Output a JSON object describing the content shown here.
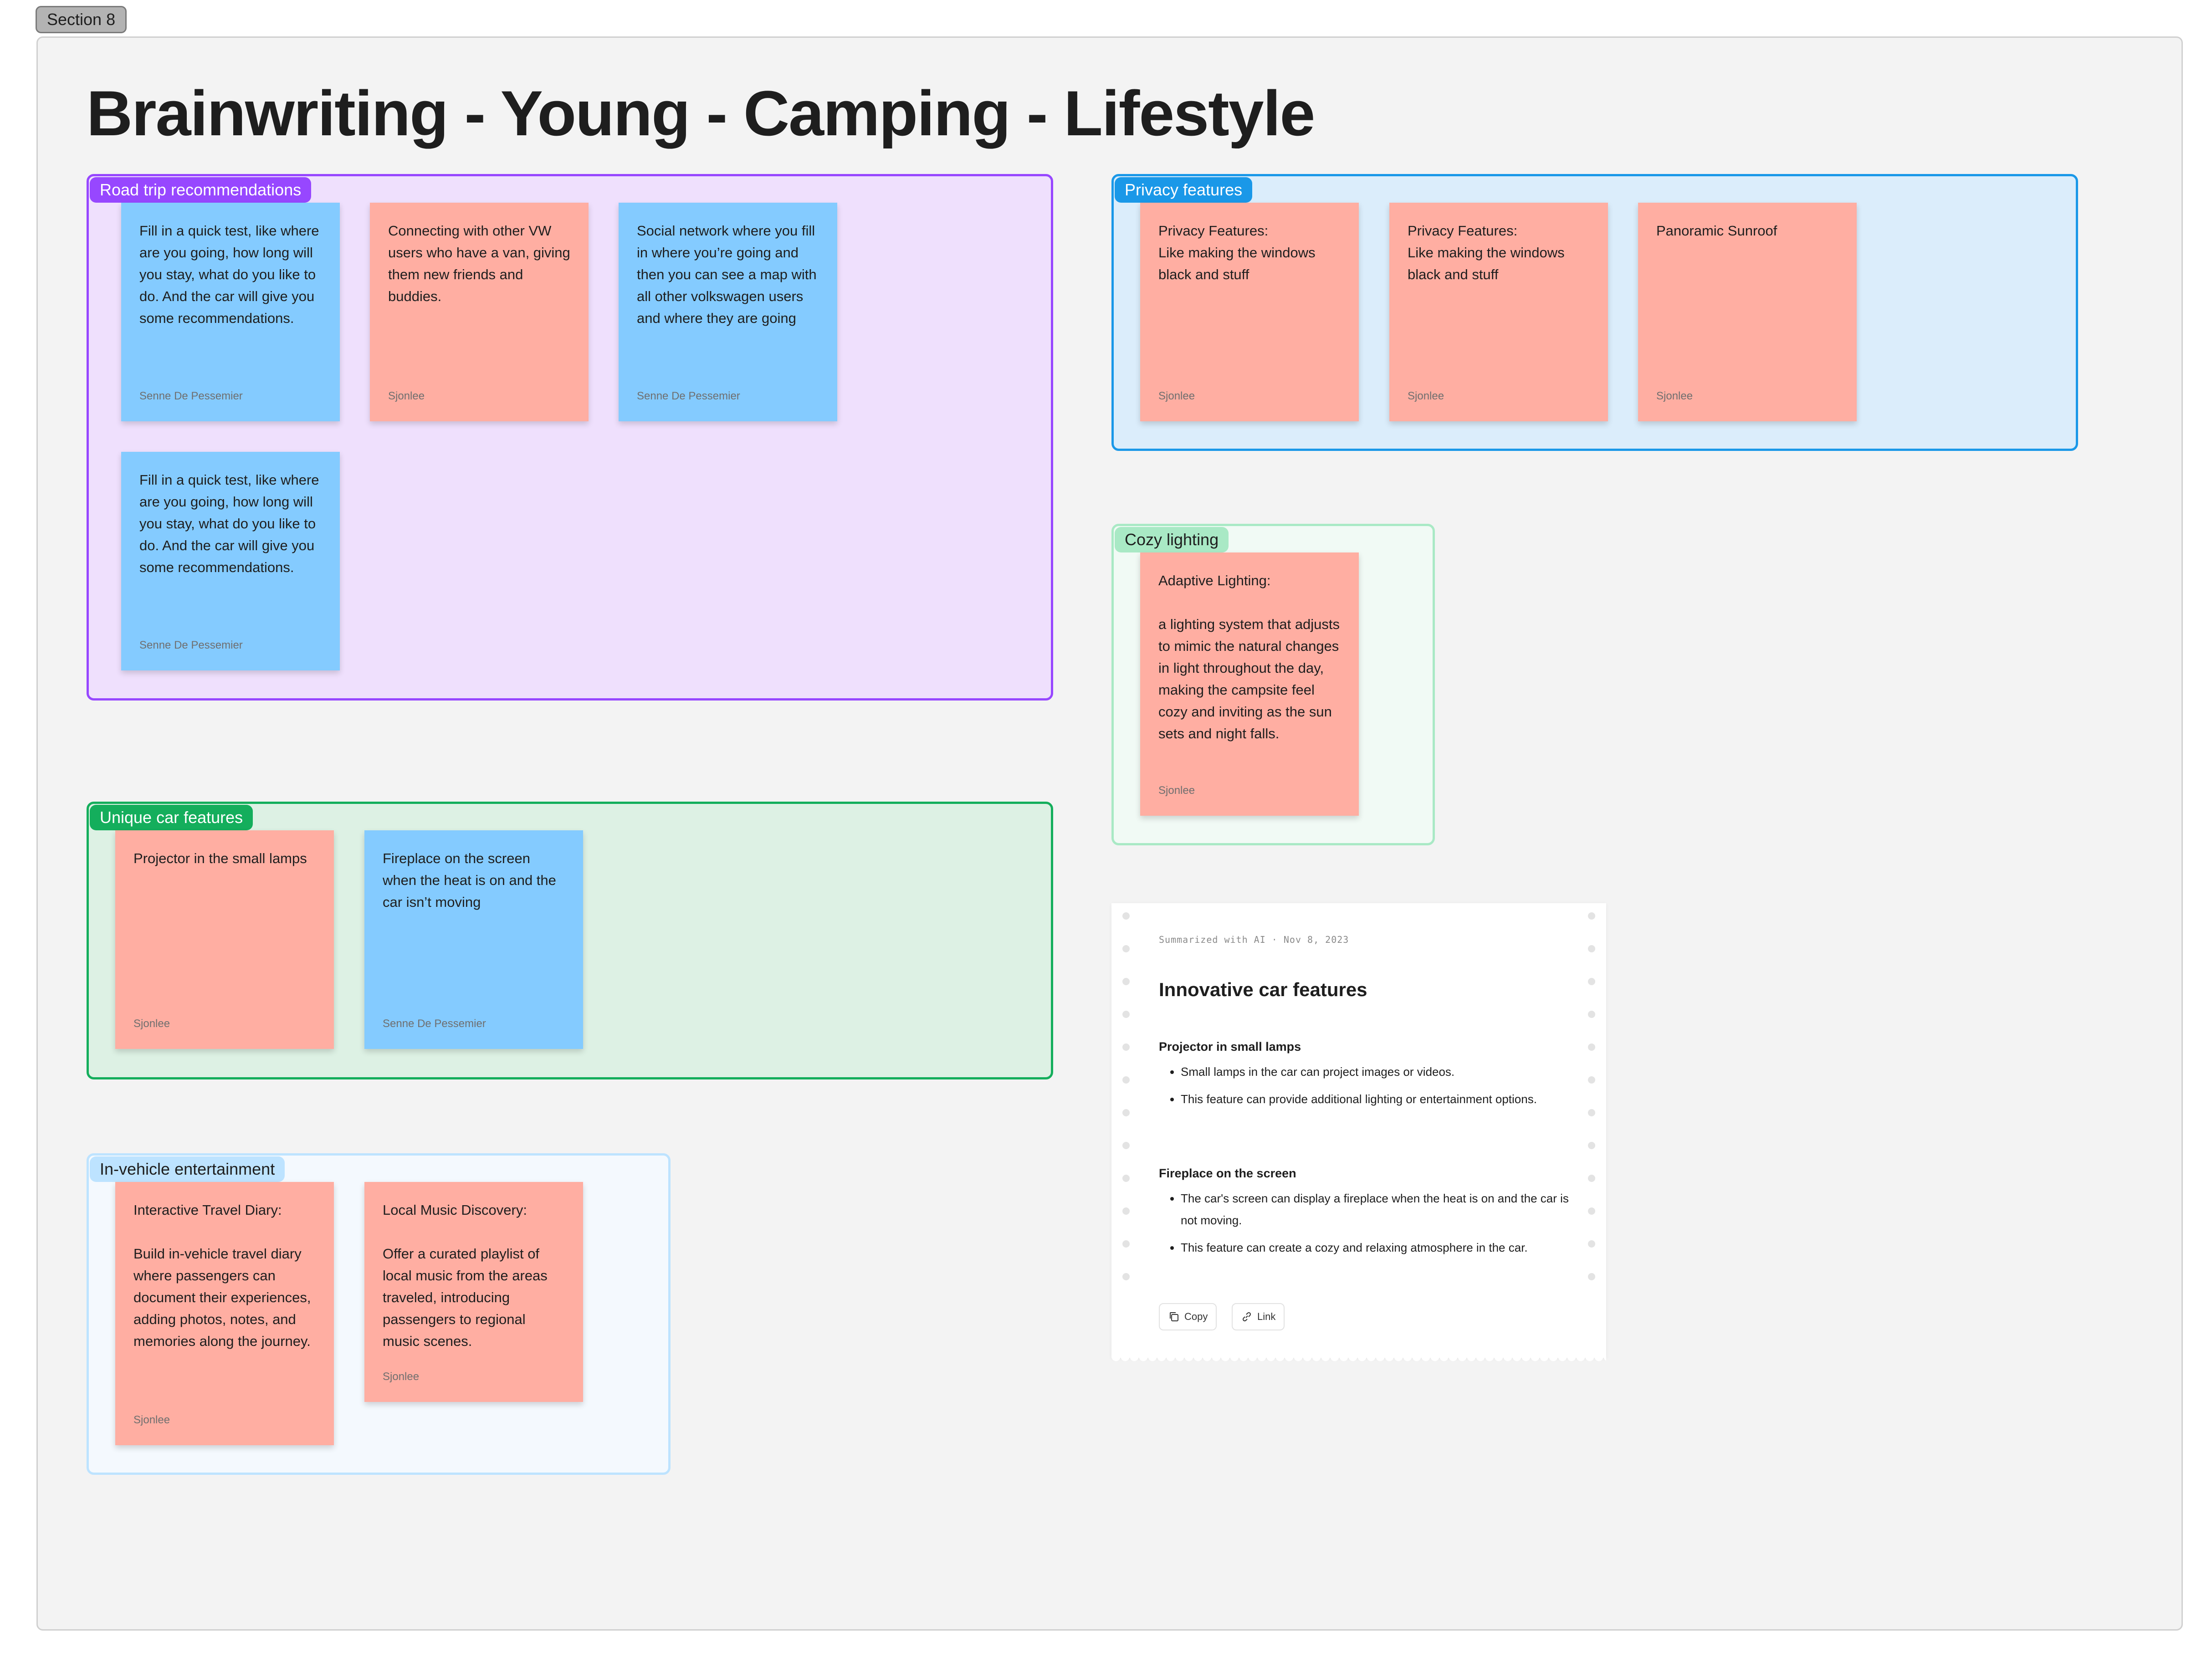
{
  "section": {
    "tag": "Section 8"
  },
  "board": {
    "title": "Brainwriting - Young - Camping - Lifestyle"
  },
  "groups": {
    "road_trip": {
      "label": "Road trip recommendations",
      "color": "#9747ff",
      "fill": "#efe0fd"
    },
    "privacy": {
      "label": "Privacy features",
      "color": "#1a98e8",
      "fill": "#dbedfb"
    },
    "cozy": {
      "label": "Cozy lighting",
      "color": "#a9e9c5",
      "fill": "#f1faf5"
    },
    "unique": {
      "label": "Unique car features",
      "color": "#14ae5c",
      "fill": "#ddf1e4"
    },
    "entertainment": {
      "label": "In-vehicle entertainment",
      "color": "#bde3ff",
      "fill": "#f4f9fe"
    }
  },
  "stickies": {
    "road_1": {
      "text": "Fill in a quick test, like where are you going, how long will you stay, what do you like to do. And the car will give you some recommendations.",
      "author": "Senne De Pessemier"
    },
    "road_2": {
      "text": "Connecting with other VW users who have a van, giving them new friends and buddies.",
      "author": "Sjonlee"
    },
    "road_3": {
      "text": "Social network where you fill in where you’re going and then you can see a map with all other volkswagen users and where they are going",
      "author": "Senne De Pessemier"
    },
    "road_4": {
      "text": "Fill in a quick test, like where are you going, how long will you stay, what do you like to do. And the car will give you some recommendations.",
      "author": "Senne De Pessemier"
    },
    "privacy_1": {
      "text": "Privacy Features:\nLike making the windows black and stuff",
      "author": "Sjonlee"
    },
    "privacy_2": {
      "text": "Privacy Features:\nLike making the windows black and stuff",
      "author": "Sjonlee"
    },
    "privacy_3": {
      "text": "Panoramic Sunroof",
      "author": "Sjonlee"
    },
    "cozy_1": {
      "text": "Adaptive Lighting:\n\na lighting system that adjusts to mimic the natural changes in light throughout the day, making the campsite feel cozy and inviting as the sun sets and night falls.",
      "author": "Sjonlee"
    },
    "unique_1": {
      "text": "Projector in the small lamps",
      "author": "Sjonlee"
    },
    "unique_2": {
      "text": "Fireplace on the screen when the heat is on and the car isn’t moving",
      "author": "Senne De Pessemier"
    },
    "ent_1": {
      "text": "Interactive Travel Diary:\n\nBuild in-vehicle travel diary where passengers can document their experiences, adding photos, notes, and memories along the journey.",
      "author": "Sjonlee"
    },
    "ent_2": {
      "text": "Local Music Discovery:\n\nOffer a curated playlist of local music from the areas traveled, introducing passengers to regional music scenes.",
      "author": "Sjonlee"
    }
  },
  "ai_summary": {
    "meta": "Summarized with AI · Nov 8, 2023",
    "title": "Innovative car features",
    "sections": [
      {
        "heading": "Projector in small lamps",
        "bullets": [
          "Small lamps in the car can project images or videos.",
          "This feature can provide additional lighting or entertainment options."
        ]
      },
      {
        "heading": "Fireplace on the screen",
        "bullets": [
          "The car's screen can display a fireplace when the heat is on and the car is not moving.",
          "This feature can create a cozy and relaxing atmosphere in the car."
        ]
      }
    ],
    "copy_label": "Copy",
    "link_label": "Link"
  },
  "colors": {
    "sticky_pink": "#ffaea2",
    "sticky_blue": "#84cbff"
  }
}
